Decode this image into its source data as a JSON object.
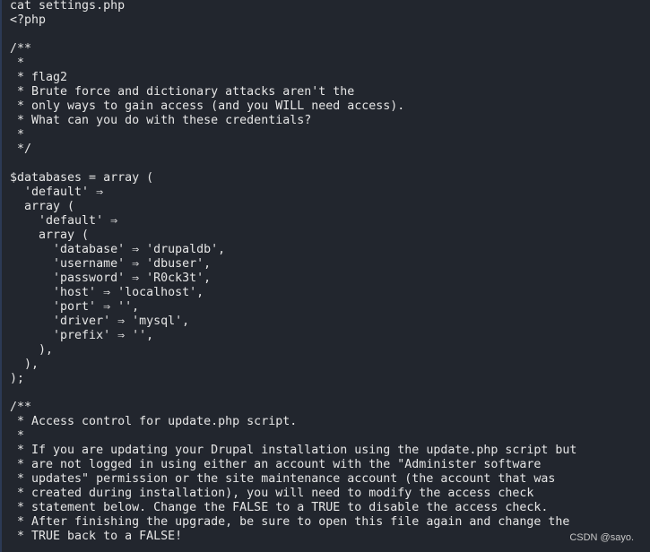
{
  "terminal": {
    "lines": [
      "cat settings.php",
      "<?php",
      "",
      "/**",
      " *",
      " * flag2",
      " * Brute force and dictionary attacks aren't the",
      " * only ways to gain access (and you WILL need access).",
      " * What can you do with these credentials?",
      " *",
      " */",
      "",
      "$databases = array (",
      "  'default' ⇒",
      "  array (",
      "    'default' ⇒",
      "    array (",
      "      'database' ⇒ 'drupaldb',",
      "      'username' ⇒ 'dbuser',",
      "      'password' ⇒ 'R0ck3t',",
      "      'host' ⇒ 'localhost',",
      "      'port' ⇒ '',",
      "      'driver' ⇒ 'mysql',",
      "      'prefix' ⇒ '',",
      "    ),",
      "  ),",
      ");",
      "",
      "/**",
      " * Access control for update.php script.",
      " *",
      " * If you are updating your Drupal installation using the update.php script but",
      " * are not logged in using either an account with the \"Administer software",
      " * updates\" permission or the site maintenance account (the account that was",
      " * created during installation), you will need to modify the access check",
      " * statement below. Change the FALSE to a TRUE to disable the access check.",
      " * After finishing the upgrade, be sure to open this file again and change the",
      " * TRUE back to a FALSE!"
    ]
  },
  "watermark": "CSDN @sayo."
}
